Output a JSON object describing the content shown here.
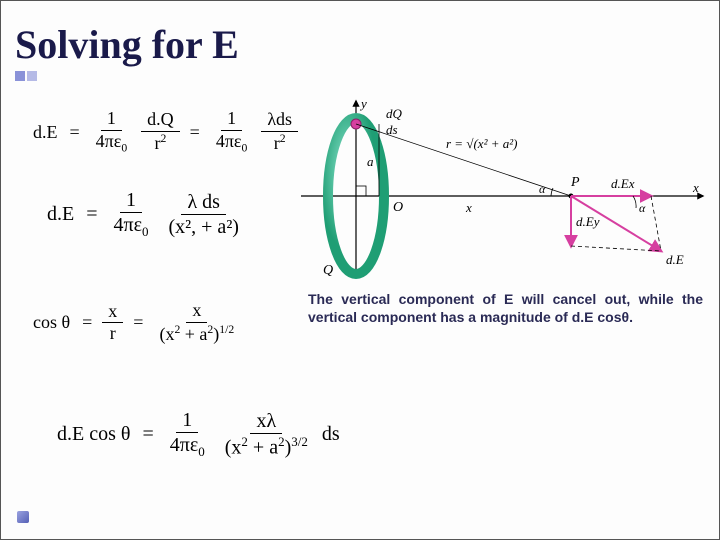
{
  "title": "Solving for E",
  "caption_line1": "The vertical component of E will cancel out,",
  "caption_line2": "while  the  vertical  component  has  a",
  "caption_line3": "magnitude of d.E cosθ.",
  "eq1": {
    "lhs": "d.E",
    "f1n": "1",
    "f1d_a": "4πε",
    "f1d_sub": "0",
    "f2n": "d.Q",
    "f2d": "r",
    "f2d_sup": "2",
    "f3n": "1",
    "f3d_a": "4πε",
    "f3d_sub": "0",
    "f4n": "λds",
    "f4d": "r",
    "f4d_sup": "2"
  },
  "eq2": {
    "lhs": "d.E",
    "f1n": "1",
    "f1d_a": "4πε",
    "f1d_sub": "0",
    "f2n": "λ ds",
    "f2d": "(x², + a²)"
  },
  "eq3": {
    "lhs": "cos θ",
    "f1n": "x",
    "f1d": "r",
    "f2n": "x",
    "f2d_open": "(",
    "f2d_a": "x",
    "f2d_a_sup": "2",
    "f2d_plus": " + a",
    "f2d_b_sup": "2",
    "f2d_close": ")",
    "f2d_outer_sup": "1/2"
  },
  "eq4": {
    "lhs": "d.E cos θ",
    "f1n": "1",
    "f1d_a": "4πε",
    "f1d_sub": "0",
    "f2n": "xλ",
    "f2d_open": "(",
    "f2d_a": "x",
    "f2d_a_sup": "2",
    "f2d_plus": " + a",
    "f2d_b_sup": "2",
    "f2d_close": ")",
    "f2d_outer_sup": "3/2",
    "tail": "ds"
  },
  "diagram": {
    "y": "y",
    "x": "x",
    "dQ": "dQ",
    "ds": "ds",
    "a": "a",
    "O": "O",
    "Q": "Q",
    "P": "P",
    "xvar": "x",
    "r_expr": "r = √(x² + a²)",
    "alpha1": "α",
    "alpha2": "α",
    "dEx": "d.Ex",
    "dEy": "d.Ey",
    "dE": "d.E"
  }
}
